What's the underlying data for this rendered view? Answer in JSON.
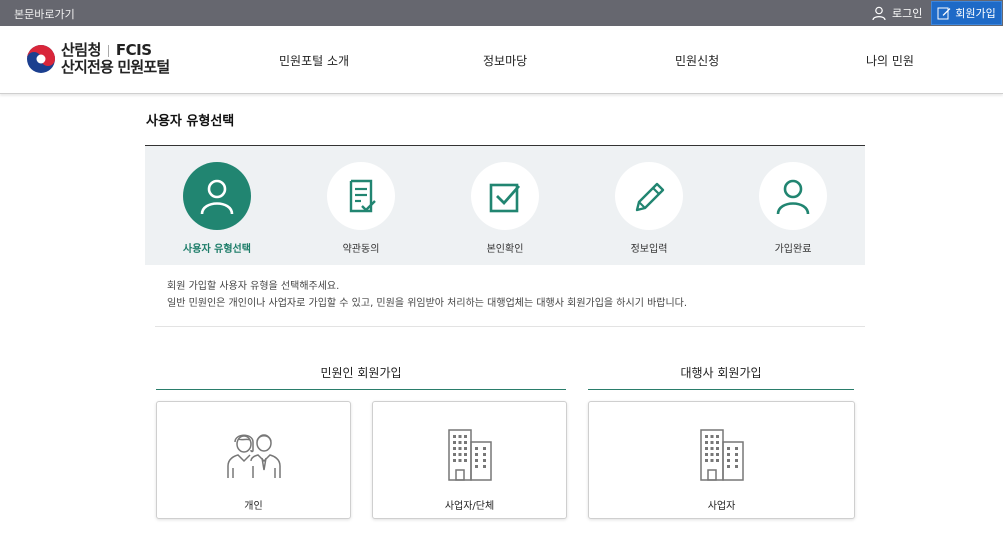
{
  "topbar": {
    "skip_link": "본문바로가기",
    "login": "로그인",
    "join": "회원가입"
  },
  "header": {
    "logo_org": "산림청",
    "logo_brand": "FCIS",
    "logo_name": "산지전용 민원포털",
    "nav": [
      "민원포털 소개",
      "정보마당",
      "민원신청",
      "나의 민원"
    ]
  },
  "page": {
    "title": "사용자 유형선택"
  },
  "steps": [
    {
      "label": "사용자 유형선택",
      "icon": "user-icon",
      "active": true
    },
    {
      "label": "약관동의",
      "icon": "document-check-icon",
      "active": false
    },
    {
      "label": "본인확인",
      "icon": "checkbox-icon",
      "active": false
    },
    {
      "label": "정보입력",
      "icon": "pencil-icon",
      "active": false
    },
    {
      "label": "가입완료",
      "icon": "user-icon",
      "active": false
    }
  ],
  "description": {
    "line1": "회원 가입할 사용자 유형을 선택해주세요.",
    "line2": "일반 민원인은 개인이나 사업자로 가입할 수 있고, 민원을 위임받아 처리하는 대행업체는 대행사 회원가입을 하시기 바랍니다."
  },
  "sections": {
    "civil": {
      "title": "민원인 회원가입",
      "cards": [
        {
          "label": "개인",
          "icon": "people-icon"
        },
        {
          "label": "사업자/단체",
          "icon": "building-icon"
        }
      ]
    },
    "agency": {
      "title": "대행사 회원가입",
      "cards": [
        {
          "label": "사업자",
          "icon": "building-icon"
        }
      ]
    }
  },
  "colors": {
    "accent": "#218571",
    "topbar": "#66676f",
    "join_button": "#1e6ac7"
  }
}
